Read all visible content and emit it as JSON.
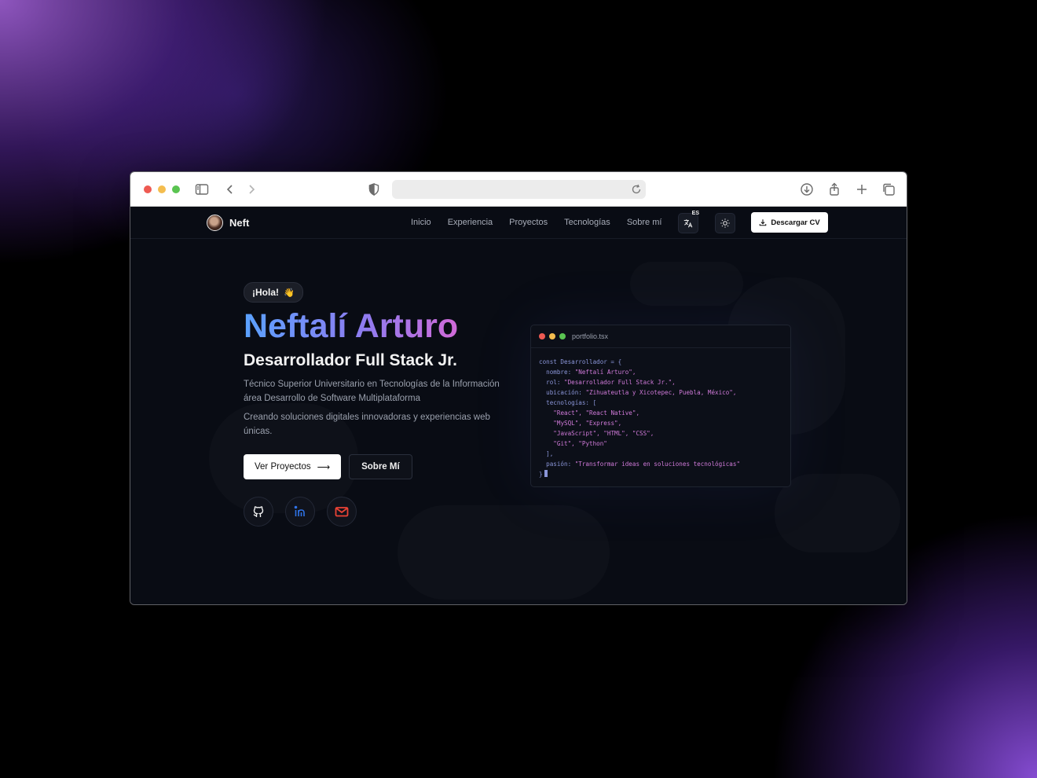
{
  "browser": {
    "url": ""
  },
  "nav": {
    "brand": "Neft",
    "links": [
      "Inicio",
      "Experiencia",
      "Proyectos",
      "Tecnologías",
      "Sobre mí"
    ],
    "language_badge": "ES",
    "cv_button": "Descargar CV"
  },
  "hero": {
    "greeting": "¡Hola!",
    "greeting_emoji": "👋",
    "name": "Neftalí Arturo",
    "role": "Desarrollador Full Stack Jr.",
    "description": "Técnico Superior Universitario en Tecnologías de la Información área Desarrollo de Software Multiplataforma",
    "tagline": "Creando soluciones digitales innovadoras y experiencias web únicas.",
    "primary_button": "Ver Proyectos",
    "primary_button_arrow": "⟶",
    "secondary_button": "Sobre Mí",
    "socials": [
      "github-icon",
      "linkedin-icon",
      "mail-icon"
    ]
  },
  "code_window": {
    "filename": "portfolio.tsx",
    "lines": [
      {
        "key": "const Desarrollador = {",
        "val": ""
      },
      {
        "key": "  nombre: ",
        "val": "\"Neftalí Arturo\","
      },
      {
        "key": "  rol: ",
        "val": "\"Desarrollador Full Stack Jr.\","
      },
      {
        "key": "  ubicación: ",
        "val": "\"Zihuateutla y Xicotepec, Puebla, México\","
      },
      {
        "key": "  tecnologías: [",
        "val": ""
      },
      {
        "key": "    ",
        "val": "\"React\", \"React Native\","
      },
      {
        "key": "    ",
        "val": "\"MySQL\", \"Express\","
      },
      {
        "key": "    ",
        "val": "\"JavaScript\", \"HTML\", \"CSS\","
      },
      {
        "key": "    ",
        "val": "\"Git\", \"Python\""
      },
      {
        "key": "  ],",
        "val": ""
      },
      {
        "key": "  pasión: ",
        "val": "\"Transformar ideas en soluciones tecnológicas\""
      },
      {
        "key": "}",
        "val": ""
      }
    ]
  },
  "colors": {
    "accent_blue": "#5aa2ff",
    "accent_pink": "#e36ac9",
    "page_bg": "#090c14"
  }
}
